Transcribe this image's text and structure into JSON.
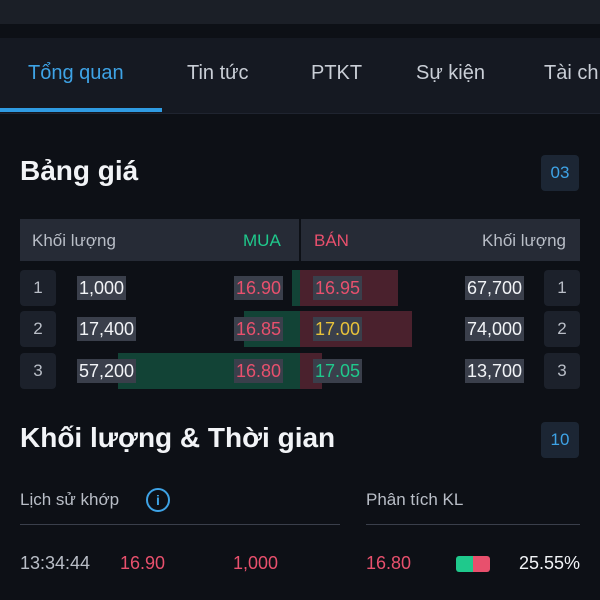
{
  "tabs": [
    {
      "label": "Tổng quan",
      "active": true
    },
    {
      "label": "Tin tức",
      "active": false
    },
    {
      "label": "PTKT",
      "active": false
    },
    {
      "label": "Sự kiện",
      "active": false
    },
    {
      "label": "Tài ch",
      "active": false
    }
  ],
  "orderbook": {
    "title": "Bảng giá",
    "badge": "03",
    "headers": {
      "buy_volume": "Khối lượng",
      "buy": "MUA",
      "sell": "BÁN",
      "sell_volume": "Khối lượng"
    },
    "rows": [
      {
        "index": "1",
        "buy_volume": "1,000",
        "buy_price": "16.90",
        "sell_price": "16.95",
        "sell_volume": "67,700",
        "sell_price_color": "red",
        "buy_depth": 0.03,
        "sell_depth": 0.35
      },
      {
        "index": "2",
        "buy_volume": "17,400",
        "buy_price": "16.85",
        "sell_price": "17.00",
        "sell_volume": "74,000",
        "sell_price_color": "yellow",
        "buy_depth": 0.2,
        "sell_depth": 0.4
      },
      {
        "index": "3",
        "buy_volume": "57,200",
        "buy_price": "16.80",
        "sell_price": "17.05",
        "sell_volume": "13,700",
        "sell_price_color": "green",
        "buy_depth": 0.65,
        "sell_depth": 0.08
      }
    ]
  },
  "volume_time": {
    "title": "Khối lượng & Thời gian",
    "badge": "10",
    "history_label": "Lịch sử khớp",
    "analysis_label": "Phân tích KL",
    "trades": [
      {
        "time": "13:34:44",
        "price": "16.90",
        "volume": "1,000"
      }
    ],
    "analysis": [
      {
        "price": "16.80",
        "percent": "25.55%"
      }
    ]
  },
  "colors": {
    "accent": "#3ea3e6",
    "buy": "#1fc98c",
    "sell": "#e8506d",
    "reference": "#e8c23a",
    "background": "#0d1016"
  }
}
